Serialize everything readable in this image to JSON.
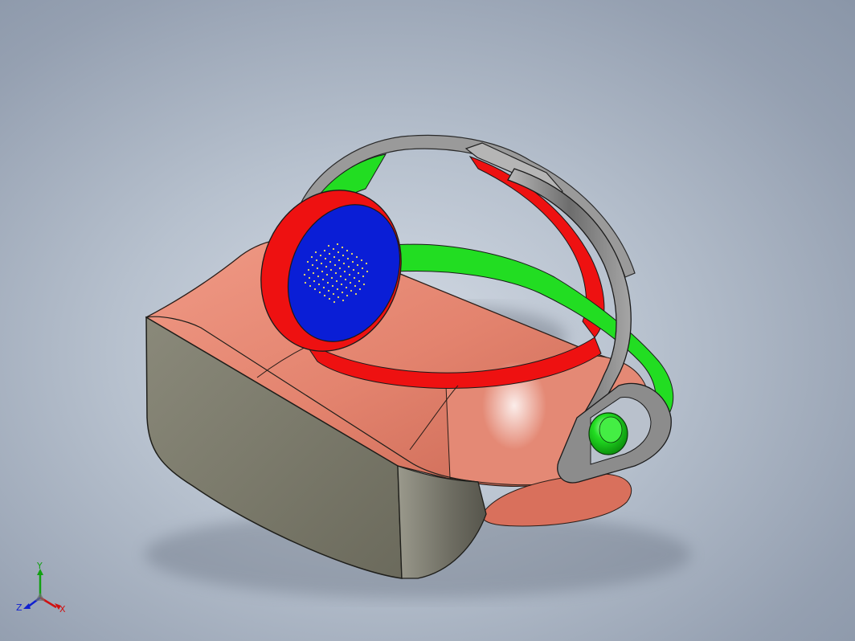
{
  "scene": {
    "colors": {
      "shell": "#e38570",
      "front_panel": "#7c7b6c",
      "band_outer": "#8d8d8d",
      "band_inner_green": "#20e020",
      "cushion_red": "#ee1111",
      "speaker_blue": "#0a1ed6",
      "knob_green": "#22dd22"
    }
  },
  "axis_triad": {
    "y_label": "Y",
    "z_label": "Z",
    "x_label": "X"
  }
}
